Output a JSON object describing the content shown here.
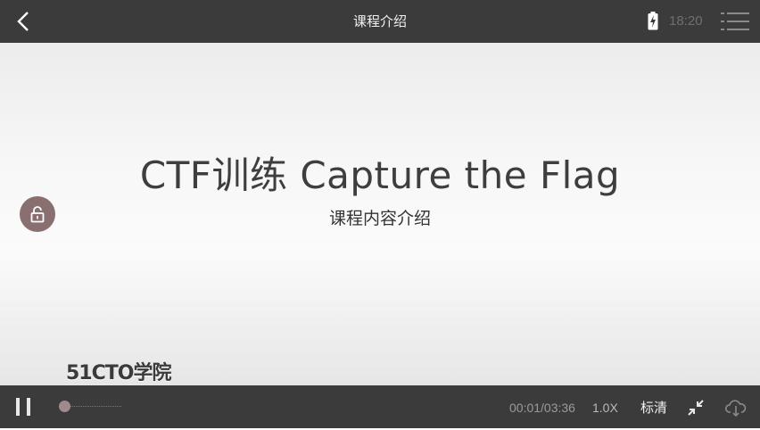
{
  "header": {
    "title": "课程介绍",
    "time": "18:20"
  },
  "slide": {
    "headline": "CTF训练 Capture the Flag",
    "subheadline": "课程内容介绍",
    "watermark": "51CTO学院"
  },
  "player": {
    "current_time": "00:01",
    "duration": "03:36",
    "time_display": "00:01/03:36",
    "progress_fraction": 0.005,
    "speed": "1.0X",
    "quality": "标清"
  },
  "colors": {
    "bar_background": "#3b3b3b",
    "lock_button": "#8a6f70",
    "progress_knob": "#a08a8c"
  },
  "icons": [
    "back-icon",
    "battery-charging-icon",
    "menu-list-icon",
    "lock-icon",
    "pause-icon",
    "collapse-icon",
    "download-icon"
  ]
}
